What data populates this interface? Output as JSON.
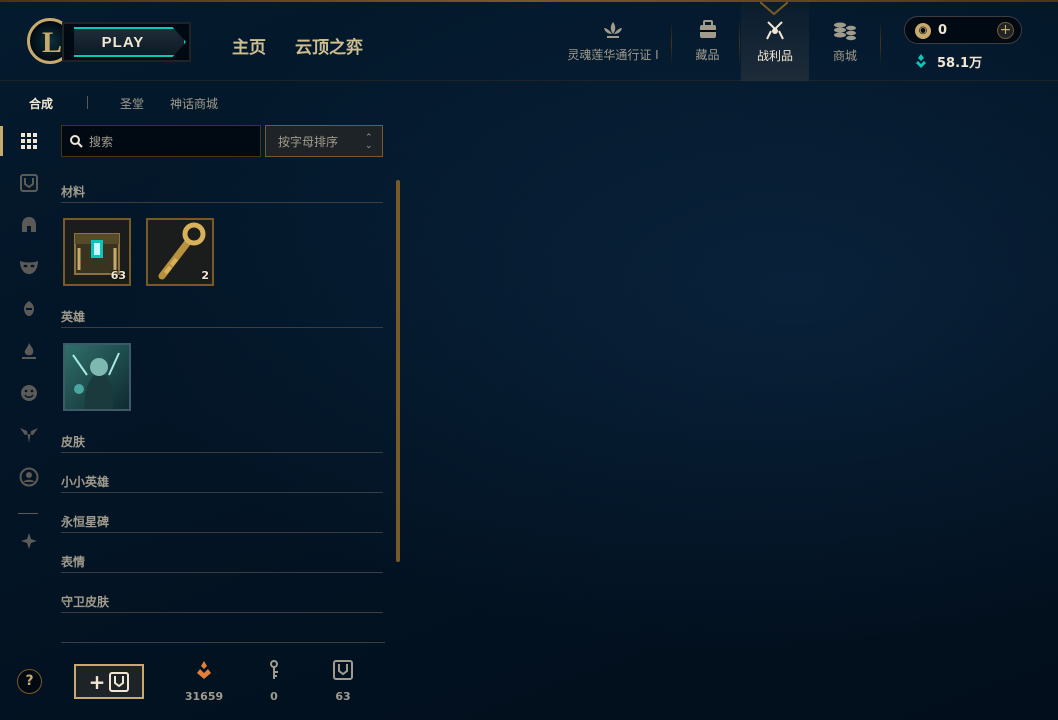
{
  "header": {
    "play_label": "PLAY",
    "nav": {
      "home": "主页",
      "tft": "云顶之弈"
    },
    "top_items": [
      {
        "label": "灵魂莲华通行证 I",
        "icon": "lotus-icon"
      },
      {
        "label": "藏品",
        "icon": "backpack-icon"
      },
      {
        "label": "战利品",
        "icon": "loot-icon",
        "active": true
      },
      {
        "label": "商城",
        "icon": "coins-icon"
      }
    ],
    "currency": {
      "rp": "0",
      "be": "58.1万"
    }
  },
  "subtabs": [
    "合成",
    "圣堂",
    "神话商城"
  ],
  "search": {
    "placeholder": "搜索"
  },
  "sort": {
    "label": "按字母排序"
  },
  "sections": [
    {
      "title": "材料"
    },
    {
      "title": "英雄"
    },
    {
      "title": "皮肤"
    },
    {
      "title": "小小英雄"
    },
    {
      "title": "永恒星碑"
    },
    {
      "title": "表情"
    },
    {
      "title": "守卫皮肤"
    }
  ],
  "materials": [
    {
      "name": "hextech-chest",
      "count": "63"
    },
    {
      "name": "hextech-key",
      "count": "2"
    }
  ],
  "footer": {
    "add_label": "+",
    "orange_essence": "31659",
    "keys": "0",
    "chests": "63"
  },
  "colors": {
    "gold": "#c8aa6e",
    "dark": "#010a13",
    "teal": "#0ac8b9"
  }
}
